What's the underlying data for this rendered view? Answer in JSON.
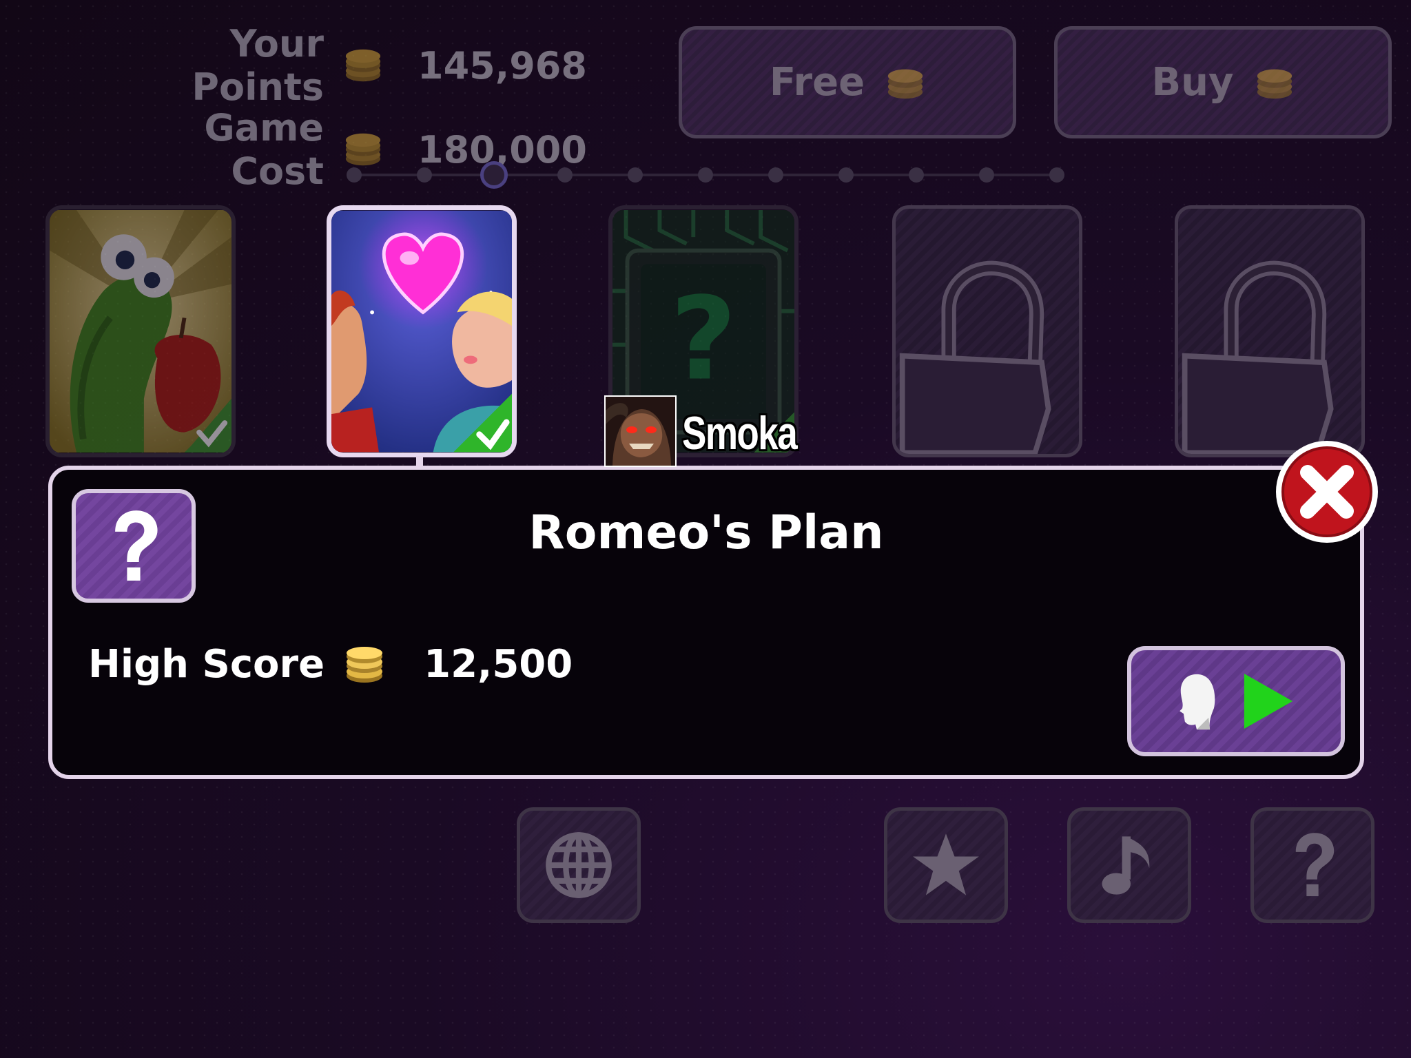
{
  "stats": {
    "points_label": "Your Points",
    "points_value": "145,968",
    "cost_label": "Game Cost",
    "cost_value": "180,000"
  },
  "top_buttons": {
    "free_label": "Free",
    "buy_label": "Buy"
  },
  "pager": {
    "total_pages": 11,
    "current_page": 3
  },
  "cards": [
    {
      "name": "caterpillar-apple",
      "completed": true,
      "state": "unlocked"
    },
    {
      "name": "romeo-plan",
      "completed": true,
      "state": "selected"
    },
    {
      "name": "mystery-circuit",
      "completed": true,
      "state": "mystery"
    },
    {
      "name": "locked-1",
      "state": "locked"
    },
    {
      "name": "locked-2",
      "state": "locked"
    }
  ],
  "panel": {
    "title": "Romeo's Plan",
    "high_score_label": "High Score",
    "high_score_value": "12,500",
    "help_icon": "question-icon",
    "play_icons": [
      "head-icon",
      "play-icon"
    ],
    "close_icon": "close-icon"
  },
  "overlay": {
    "user_name": "Smoka"
  },
  "bottom_buttons": [
    "globe-icon",
    "star-icon",
    "music-note-icon",
    "question-icon"
  ],
  "colors": {
    "accent_purple": "#6a3e94",
    "close_red": "#c0141d",
    "play_green": "#21d31b"
  }
}
